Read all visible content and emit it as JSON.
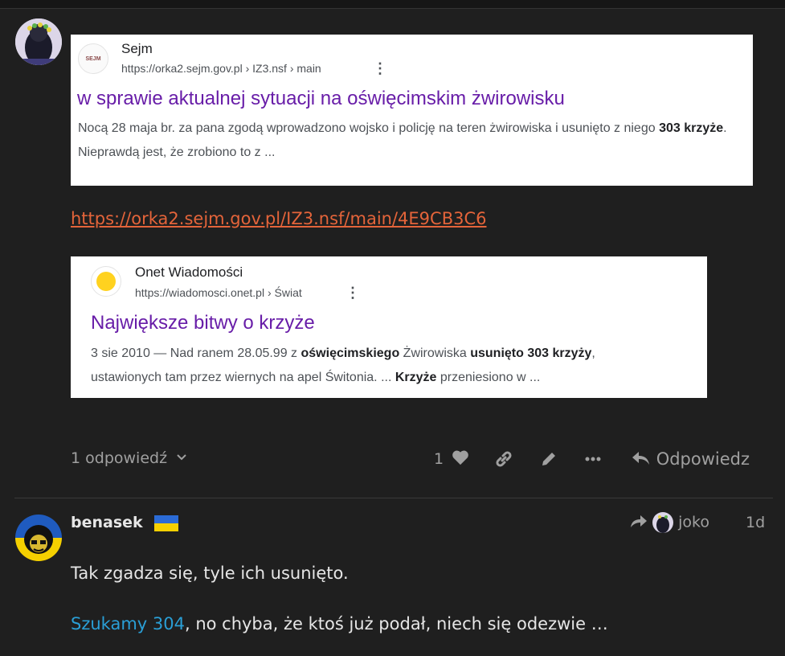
{
  "post1": {
    "card1": {
      "site": "Sejm",
      "favicon_text": "SEJM",
      "url": "https://orka2.sejm.gov.pl › IZ3.nsf › main",
      "headline": "w sprawie aktualnej sytuacji na oświęcimskim żwirowisku",
      "snippet_a": "Nocą 28 maja br. za pana zgodą wprowadzono wojsko i policję na teren żwirowiska i usunięto z niego ",
      "snippet_b": "303 krzyże",
      "snippet_c": ". Nieprawdą jest, że zrobiono to z ..."
    },
    "link": "https://orka2.sejm.gov.pl/IZ3.nsf/main/4E9CB3C6",
    "card2": {
      "site": "Onet Wiadomości",
      "url": "https://wiadomosci.onet.pl › Świat",
      "headline": "Największe bitwy o krzyże",
      "s1": "3 sie 2010 — Nad ranem 28.05.99 z ",
      "s2": "oświęcimskiego",
      "s3": " Żwirowiska ",
      "s4": "usunięto 303 krzyży",
      "s5": ",",
      "s6": "ustawionych tam przez wiernych na apel Świtonia. ... ",
      "s7": "Krzyże",
      "s8": " przeniesiono w ..."
    },
    "replies_label": "1 odpowiedź",
    "like_count": "1",
    "reply_label": "Odpowiedz"
  },
  "post2": {
    "username": "benasek",
    "reply_to": "joko",
    "time": "1d",
    "line1": "Tak zgadza się, tyle ich usunięto.",
    "mention": "Szukamy 304",
    "line2_rest": ", no chyba, że ktoś już podał, niech się odezwie …"
  }
}
